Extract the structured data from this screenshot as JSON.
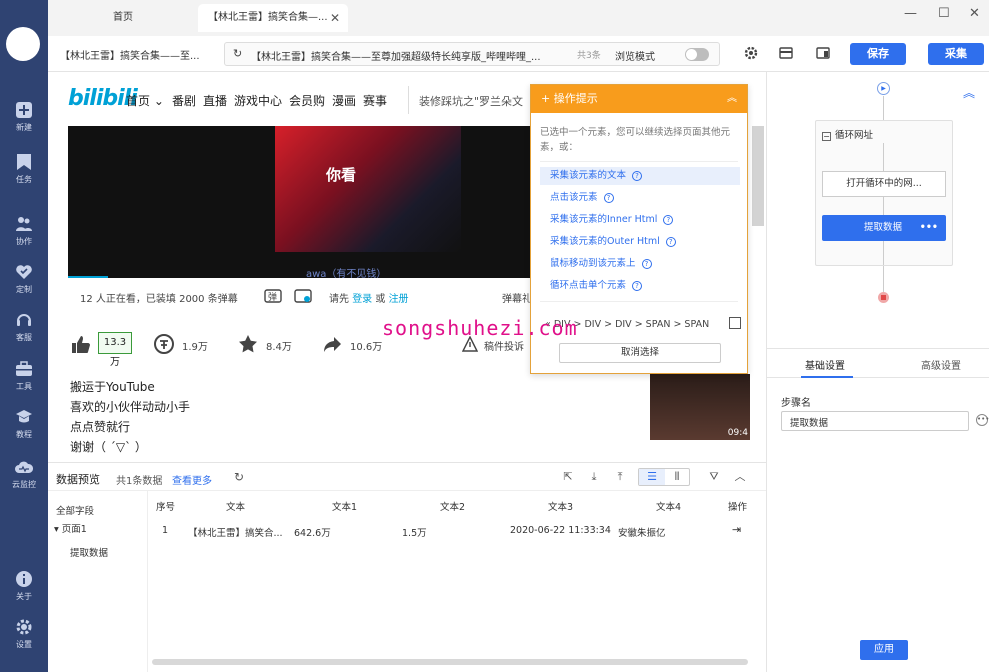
{
  "sidebar": {
    "items": [
      {
        "label": "新建",
        "icon": "plus-square-icon"
      },
      {
        "label": "任务",
        "icon": "bookmark-icon"
      },
      {
        "label": "协作",
        "icon": "users-icon"
      },
      {
        "label": "定制",
        "icon": "heart-check-icon"
      },
      {
        "label": "客服",
        "icon": "headset-icon"
      },
      {
        "label": "工具",
        "icon": "toolbox-icon"
      },
      {
        "label": "教程",
        "icon": "graduation-cap-icon"
      },
      {
        "label": "云监控",
        "icon": "cloud-monitor-icon"
      },
      {
        "label": "关于",
        "icon": "info-icon"
      },
      {
        "label": "设置",
        "icon": "gear-icon"
      }
    ]
  },
  "tabs": [
    {
      "label": "首页"
    },
    {
      "label": "【林北王雷】搞笑合集—..."
    }
  ],
  "toolbar": {
    "crumb": "【林北王雷】搞笑合集——至...",
    "url": "【林北王雷】搞笑合集——至尊加强超级特长纯享版_哔哩哔哩_...",
    "count": "共3条",
    "mode_label": "浏览模式",
    "save_label": "保存",
    "collect_label": "采集"
  },
  "bili": {
    "logo": "bilibili",
    "nav": [
      "首页",
      "番剧",
      "直播",
      "游戏中心",
      "会员购",
      "漫画",
      "赛事"
    ],
    "search_text": "装修踩坑之\"罗兰朵文",
    "video_caption": "你看",
    "video_sub": "awa（有不见钱）",
    "watching": "12 人正在看，已装填 2000 条弹幕",
    "login_prompt": "请先",
    "login_link": "登录",
    "or": "或",
    "register_link": "注册",
    "danmaku_label": "弹幕礼",
    "likes": "13.3万",
    "coins": "1.9万",
    "favs": "8.4万",
    "shares": "10.6万",
    "report": "稿件投诉",
    "desc": [
      "搬运于YouTube",
      "喜欢的小伙伴动动小手",
      "点点赞就行",
      "谢谢（ ´▽` ）"
    ],
    "side_time": "09:4"
  },
  "tips": {
    "title": "操作提示",
    "intro": "已选中一个元素，您可以继续选择页面其他元素，或：",
    "options": [
      "采集该元素的文本",
      "点击该元素",
      "采集该元素的Inner Html",
      "采集该元素的Outer Html",
      "鼠标移动到该元素上",
      "循环点击单个元素"
    ],
    "path": "« DIV > DIV > DIV > SPAN > SPAN",
    "cancel": "取消选择"
  },
  "watermark": "songshuhezi.com",
  "data_preview": {
    "title": "数据预览",
    "count": "共1条数据",
    "more": "查看更多",
    "tree": {
      "all": "全部字段",
      "page": "页面1",
      "step": "提取数据"
    },
    "columns": [
      "序号",
      "文本",
      "文本1",
      "文本2",
      "文本3",
      "文本4",
      "操作"
    ],
    "rows": [
      [
        "1",
        "【林北王雷】搞笑合...",
        "642.6万",
        "1.5万",
        "2020-06-22 11:33:34",
        "安徽朱振亿"
      ]
    ]
  },
  "flow": {
    "loop_label": "循环网址",
    "open_label": "打开循环中的网...",
    "extract_label": "提取数据"
  },
  "settings": {
    "tab_basic": "基础设置",
    "tab_advanced": "高级设置",
    "step_name_label": "步骤名",
    "step_name_value": "提取数据",
    "apply_label": "应用"
  },
  "colors": {
    "sidebar_bg": "#2f4372",
    "accent": "#2f6fed",
    "tips_header": "#f89c1c",
    "bili_blue": "#00a1d6",
    "watermark": "#e0108a"
  }
}
